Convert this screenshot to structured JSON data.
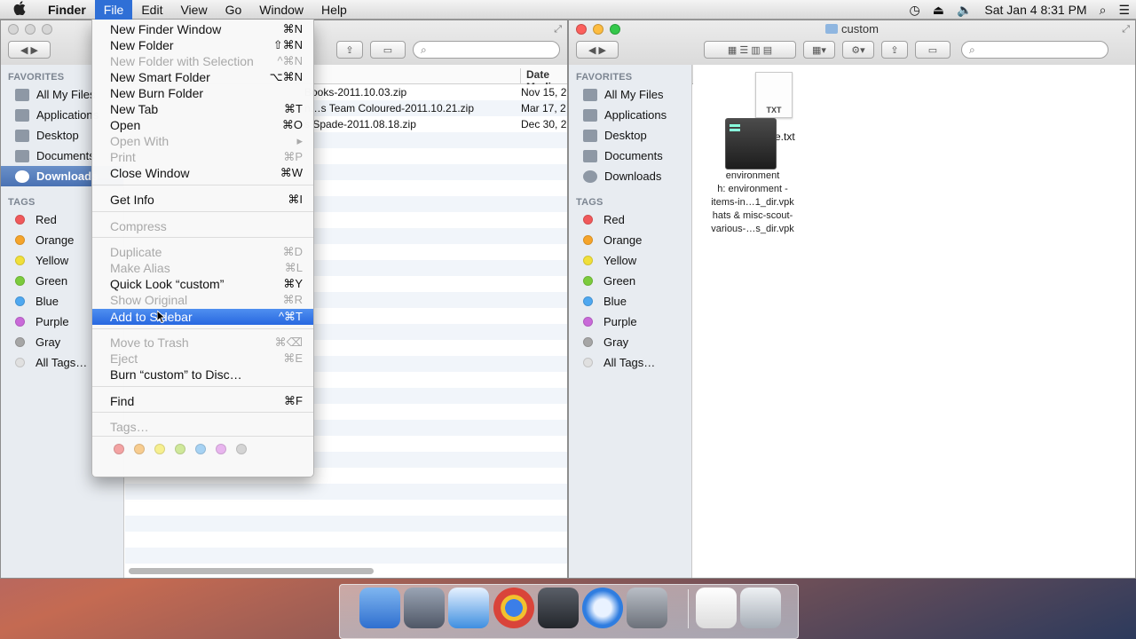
{
  "menubar": {
    "apple": "",
    "items": [
      "Finder",
      "File",
      "Edit",
      "View",
      "Go",
      "Window",
      "Help"
    ],
    "clock": "Sat Jan 4  8:31 PM"
  },
  "file_menu": {
    "items": [
      {
        "label": "New Finder Window",
        "shortcut": "⌘N",
        "enabled": true
      },
      {
        "label": "New Folder",
        "shortcut": "⇧⌘N",
        "enabled": true
      },
      {
        "label": "New Folder with Selection",
        "shortcut": "^⌘N",
        "enabled": false
      },
      {
        "label": "New Smart Folder",
        "shortcut": "⌥⌘N",
        "enabled": true
      },
      {
        "label": "New Burn Folder",
        "shortcut": "",
        "enabled": true
      },
      {
        "label": "New Tab",
        "shortcut": "⌘T",
        "enabled": true
      },
      {
        "label": "Open",
        "shortcut": "⌘O",
        "enabled": true
      },
      {
        "label": "Open With",
        "shortcut": "▸",
        "enabled": false
      },
      {
        "label": "Print",
        "shortcut": "⌘P",
        "enabled": false
      },
      {
        "label": "Close Window",
        "shortcut": "⌘W",
        "enabled": true
      },
      {
        "label": "Get Info",
        "shortcut": "⌘I",
        "enabled": true
      },
      {
        "label": "Compress",
        "shortcut": "",
        "enabled": false
      },
      {
        "label": "Duplicate",
        "shortcut": "⌘D",
        "enabled": false
      },
      {
        "label": "Make Alias",
        "shortcut": "⌘L",
        "enabled": false
      },
      {
        "label": "Quick Look “custom”",
        "shortcut": "⌘Y",
        "enabled": true
      },
      {
        "label": "Show Original",
        "shortcut": "⌘R",
        "enabled": false
      },
      {
        "label": "Add to Sidebar",
        "shortcut": "^⌘T",
        "enabled": true,
        "highlighted": true
      },
      {
        "label": "Move to Trash",
        "shortcut": "⌘⌫",
        "enabled": false
      },
      {
        "label": "Eject",
        "shortcut": "⌘E",
        "enabled": false
      },
      {
        "label": "Burn “custom” to Disc…",
        "shortcut": "",
        "enabled": true
      },
      {
        "label": "Find",
        "shortcut": "⌘F",
        "enabled": true
      },
      {
        "label": "Tags…",
        "shortcut": "",
        "enabled": false
      }
    ],
    "tag_colors": [
      "#f3a3a3",
      "#f7cc8f",
      "#f6ef8f",
      "#cfe89a",
      "#a6d2f3",
      "#e8b5ee",
      "#d4d4d4"
    ]
  },
  "sidebar": {
    "favorites_header": "FAVORITES",
    "favorites": [
      "All My Files",
      "Applications",
      "Desktop",
      "Documents",
      "Downloads"
    ],
    "tags_header": "TAGS",
    "tags": [
      {
        "label": "Red",
        "color": "#f0595b"
      },
      {
        "label": "Orange",
        "color": "#f5a42a"
      },
      {
        "label": "Yellow",
        "color": "#f0df3a"
      },
      {
        "label": "Green",
        "color": "#7ccb3d"
      },
      {
        "label": "Blue",
        "color": "#4fa8f0"
      },
      {
        "label": "Purple",
        "color": "#c96ad9"
      },
      {
        "label": "Gray",
        "color": "#a6a6a6"
      },
      {
        "label": "All Tags…",
        "color": "#e0e0e0"
      }
    ]
  },
  "left_window": {
    "column_date": "Date Modi",
    "files": [
      {
        "name": "Books-2011.10.03.zip",
        "date": "Nov 15, 2"
      },
      {
        "name": "n…s Team Coloured-2011.10.21.zip",
        "date": "Mar 17, 2"
      },
      {
        "name": "s Spade-2011.08.18.zip",
        "date": "Dec 30, 2"
      }
    ]
  },
  "right_window": {
    "title": "custom",
    "txt_file": {
      "badge": "TXT",
      "label": "e.txt"
    },
    "vpk_file": {
      "label_lines": [
        "environment",
        "h:  environment  -",
        "items-in…1_dir.vpk",
        "hats & misc-scout-",
        "various-…s_dir.vpk"
      ]
    }
  },
  "dock": {
    "apps": [
      "Finder",
      "Launchpad",
      "Safari",
      "Chrome",
      "Steam",
      "QuickTime Player",
      "System Preferences",
      "Archive",
      "Trash"
    ]
  }
}
